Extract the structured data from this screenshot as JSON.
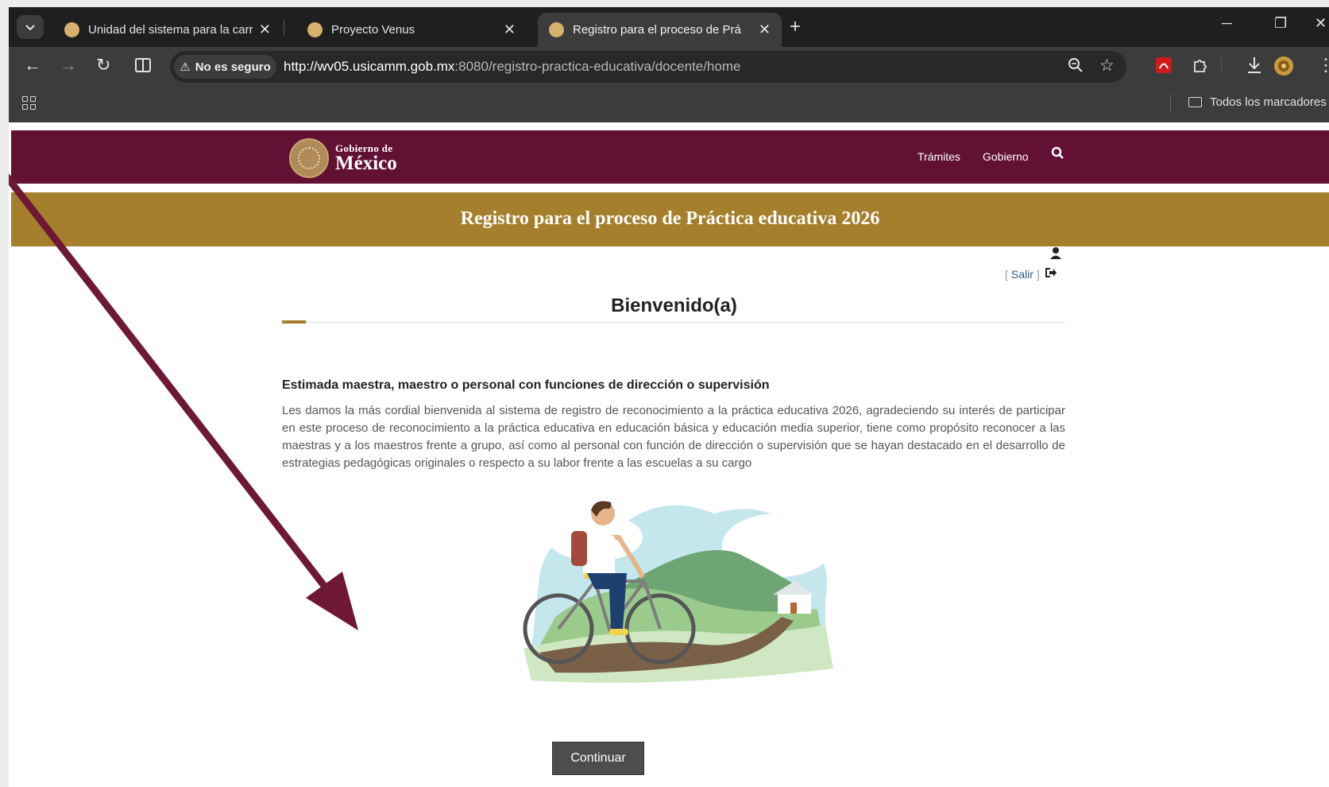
{
  "browser": {
    "tabs": [
      {
        "title": "Unidad del sistema para la carr",
        "active": false
      },
      {
        "title": "Proyecto Venus",
        "active": false
      },
      {
        "title": "Registro para el proceso de Prá",
        "active": true
      }
    ],
    "security_label": "No es seguro",
    "url_host": "http://wv05.usicamm.gob.mx",
    "url_rest": ":8080/registro-practica-educativa/docente/home",
    "bookmarks_folder": "Todos los marcadores"
  },
  "header": {
    "logo_small": "Gobierno de",
    "logo_big": "México",
    "nav": [
      "Trámites",
      "Gobierno"
    ]
  },
  "banner": {
    "title": "Registro para el proceso de Práctica educativa 2026"
  },
  "session": {
    "logout_label": "Salir",
    "bracket_open": "[",
    "bracket_close": "]"
  },
  "content": {
    "heading": "Bienvenido(a)",
    "greeting": "Estimada maestra, maestro o personal con funciones de dirección o supervisión",
    "intro": "Les damos la más cordial bienvenida al sistema de registro de reconocimiento a la práctica educativa 2026, agradeciendo su interés de participar en este proceso de reconocimiento a la práctica educativa en educación básica y educación media superior, tiene como propósito reconocer a las maestras y a los maestros frente a grupo, así como al personal con función de dirección o supervisión que se hayan destacado en el desarrollo de estrategias pedagógicas originales o respecto a su labor frente a las escuelas a su cargo",
    "continue_label": "Continuar"
  },
  "colors": {
    "gov_header": "#621132",
    "banner": "#a57f2c",
    "arrow": "#6e1836"
  },
  "icons": [
    "chevron-down-icon",
    "back-icon",
    "forward-icon",
    "reload-icon",
    "split-view-icon",
    "warning-icon",
    "zoom-icon",
    "star-icon",
    "pdf-extension-icon",
    "extensions-icon",
    "download-icon",
    "profile-avatar",
    "more-icon",
    "apps-icon",
    "folder-icon",
    "search-icon",
    "user-icon",
    "logout-icon"
  ]
}
